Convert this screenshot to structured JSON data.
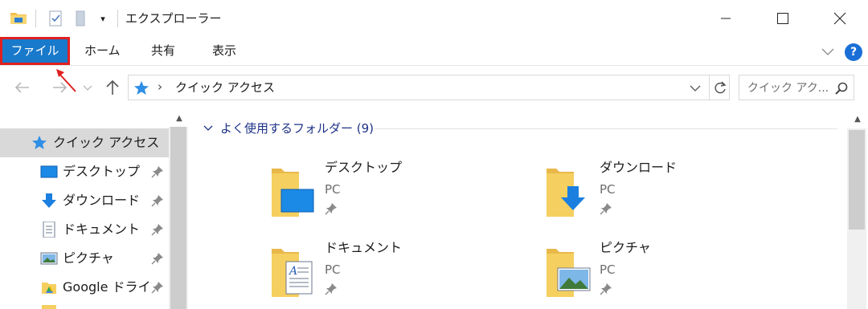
{
  "window": {
    "title": "エクスプローラー"
  },
  "ribbon": {
    "tabs": [
      "ファイル",
      "ホーム",
      "共有",
      "表示"
    ],
    "help_label": "?"
  },
  "nav": {
    "address_chevron": "›",
    "address_path": "クイック アクセス",
    "search_placeholder": "クイック アク..."
  },
  "sidebar": {
    "items": [
      {
        "label": "クイック アクセス",
        "icon": "star-icon",
        "pinned": false,
        "selected": true
      },
      {
        "label": "デスクトップ",
        "icon": "desktop-icon",
        "pinned": true
      },
      {
        "label": "ダウンロード",
        "icon": "download-icon",
        "pinned": true
      },
      {
        "label": "ドキュメント",
        "icon": "document-icon",
        "pinned": true
      },
      {
        "label": "ピクチャ",
        "icon": "picture-icon",
        "pinned": true
      },
      {
        "label": "Google ドライブ",
        "icon": "google-drive-icon",
        "pinned": true
      }
    ]
  },
  "main": {
    "group_title": "よく使用するフォルダー (9)",
    "folders": [
      {
        "name": "デスクトップ",
        "location": "PC",
        "icon": "desktop-folder-icon"
      },
      {
        "name": "ダウンロード",
        "location": "PC",
        "icon": "download-folder-icon"
      },
      {
        "name": "ドキュメント",
        "location": "PC",
        "icon": "document-folder-icon"
      },
      {
        "name": "ピクチャ",
        "location": "PC",
        "icon": "picture-folder-icon"
      }
    ]
  },
  "colors": {
    "file_tab_bg": "#1979ca",
    "highlight_border": "#e02020",
    "group_title": "#1e3287",
    "folder_yellow": "#f5cf5f"
  }
}
